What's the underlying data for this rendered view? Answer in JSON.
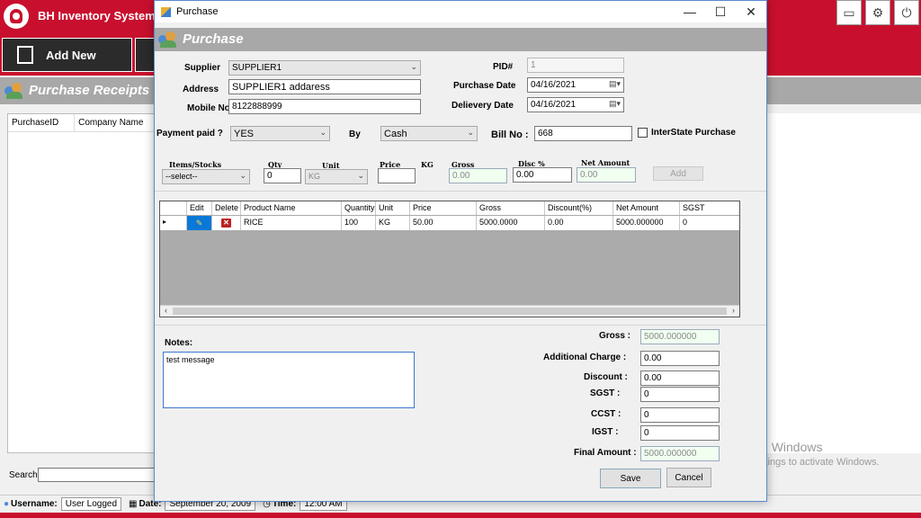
{
  "app": {
    "title": "BH Inventory System",
    "header_icons": [
      "window-icon",
      "gear-icon",
      "power-icon"
    ],
    "add_new_label": "Add New",
    "receipts_title": "Purchase Receipts",
    "grid_columns": [
      "PurchaseID",
      "Company Name"
    ],
    "search_label": "Search:",
    "status": {
      "username_label": "Username:",
      "username_value": "User Logged",
      "date_label": "Date:",
      "date_value": "September 20, 2009",
      "time_label": "Time:",
      "time_value": "12:00 AM"
    },
    "watermark_title": "Activate Windows",
    "watermark_sub": "Go to Settings to activate Windows."
  },
  "dialog": {
    "window_title": "Purchase",
    "band_title": "Purchase",
    "supplier_label": "Supplier",
    "supplier_value": "SUPPLIER1",
    "address_label": "Address",
    "address_value": "SUPPLIER1 addaress",
    "mobile_label": "Mobile No",
    "mobile_value": "8122888999",
    "pid_label": "PID#",
    "pid_value": "1",
    "purchase_date_label": "Purchase Date",
    "purchase_date_value": "04/16/2021",
    "delivery_date_label": "Delievery Date",
    "delivery_date_value": "04/16/2021",
    "payment_label": "Payment paid ?",
    "payment_value": "YES",
    "by_label": "By",
    "by_value": "Cash",
    "bill_label": "Bill No :",
    "bill_value": "668",
    "interstate_label": "InterState Purchase",
    "item_labels": {
      "items": "Items/Stocks",
      "qty": "Qty",
      "unit": "Unit",
      "price": "Price",
      "kg": "KG",
      "gross": "Gross",
      "disc": "Disc %",
      "net": "Net Amount"
    },
    "item_values": {
      "item": "--select--",
      "qty": "0",
      "unit": "KG",
      "price": "",
      "gross": "0.00",
      "disc": "0.00",
      "net": "0.00"
    },
    "add_button": "Add",
    "grid": {
      "columns": [
        "Edit",
        "Delete",
        "Product Name",
        "Quantity",
        "Unit",
        "Price",
        "Gross",
        "Discount(%)",
        "Net Amount",
        "SGST"
      ],
      "rows": [
        {
          "product": "RICE",
          "quantity": "100",
          "unit": "KG",
          "price": "50.00",
          "gross": "5000.0000",
          "discount": "0.00",
          "net": "5000.000000",
          "sgst": "0"
        }
      ]
    },
    "notes_label": "Notes:",
    "notes_value": "test message",
    "totals": {
      "gross_label": "Gross :",
      "gross_value": "5000.000000",
      "additional_label": "Additional Charge  :",
      "additional_value": "0.00",
      "discount_label": "Discount  :",
      "discount_value": "0.00",
      "sgst_label": "SGST :",
      "sgst_value": "0",
      "ccst_label": "CCST  :",
      "ccst_value": "0",
      "igst_label": "IGST :",
      "igst_value": "0",
      "final_label": "Final Amount :",
      "final_value": "5000.000000"
    },
    "save_button": "Save",
    "cancel_button": "Cancel"
  }
}
